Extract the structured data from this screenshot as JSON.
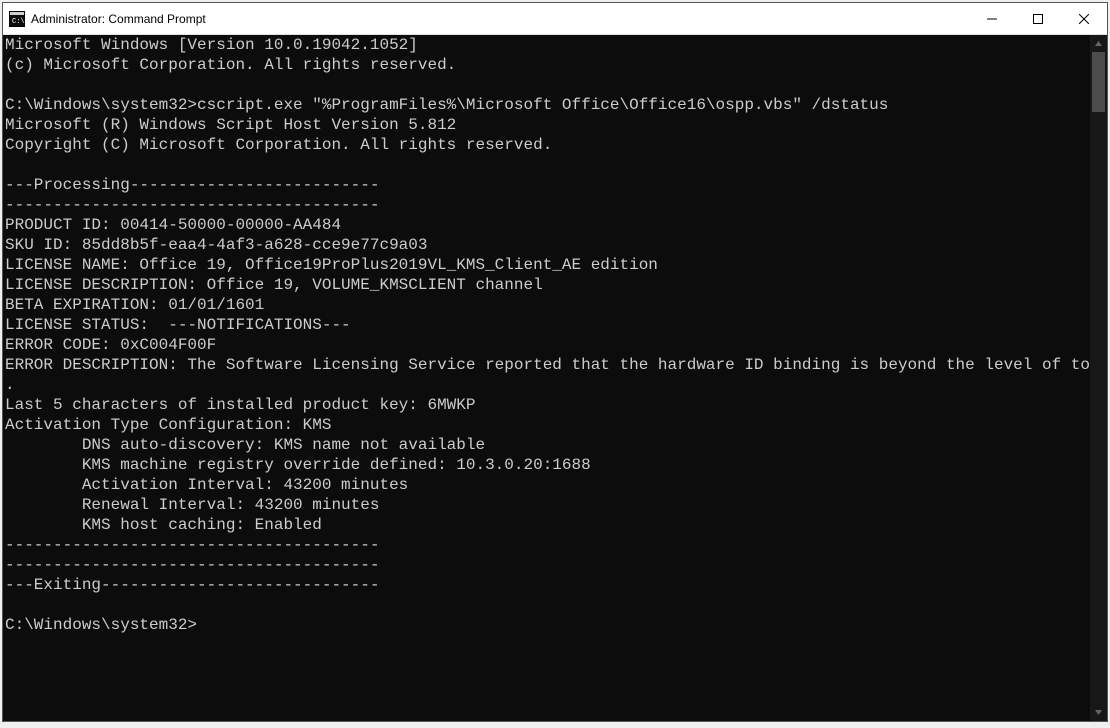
{
  "window": {
    "title": "Administrator: Command Prompt"
  },
  "terminal": {
    "lines": [
      "Microsoft Windows [Version 10.0.19042.1052]",
      "(c) Microsoft Corporation. All rights reserved.",
      "",
      "C:\\Windows\\system32>cscript.exe \"%ProgramFiles%\\Microsoft Office\\Office16\\ospp.vbs\" /dstatus",
      "Microsoft (R) Windows Script Host Version 5.812",
      "Copyright (C) Microsoft Corporation. All rights reserved.",
      "",
      "---Processing--------------------------",
      "---------------------------------------",
      "PRODUCT ID: 00414-50000-00000-AA484",
      "SKU ID: 85dd8b5f-eaa4-4af3-a628-cce9e77c9a03",
      "LICENSE NAME: Office 19, Office19ProPlus2019VL_KMS_Client_AE edition",
      "LICENSE DESCRIPTION: Office 19, VOLUME_KMSCLIENT channel",
      "BETA EXPIRATION: 01/01/1601",
      "LICENSE STATUS:  ---NOTIFICATIONS---",
      "ERROR CODE: 0xC004F00F",
      "ERROR DESCRIPTION: The Software Licensing Service reported that the hardware ID binding is beyond the level of tolerance",
      ".",
      "Last 5 characters of installed product key: 6MWKP",
      "Activation Type Configuration: KMS",
      "        DNS auto-discovery: KMS name not available",
      "        KMS machine registry override defined: 10.3.0.20:1688",
      "        Activation Interval: 43200 minutes",
      "        Renewal Interval: 43200 minutes",
      "        KMS host caching: Enabled",
      "---------------------------------------",
      "---------------------------------------",
      "---Exiting-----------------------------",
      "",
      "C:\\Windows\\system32>"
    ]
  }
}
